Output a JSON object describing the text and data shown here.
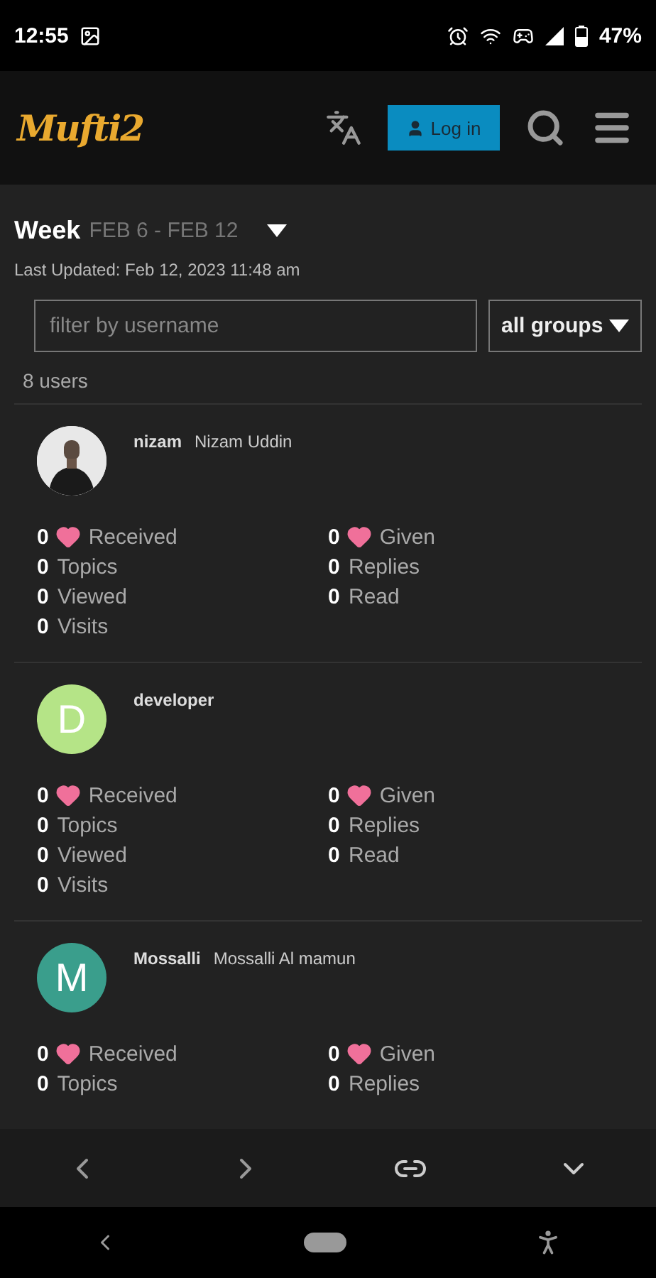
{
  "status_bar": {
    "time": "12:55",
    "battery": "47%"
  },
  "header": {
    "logo": "Mufti2",
    "login": "Log in"
  },
  "period": {
    "label": "Week",
    "range": "FEB 6 - FEB 12",
    "updated": "Last Updated: Feb 12, 2023 11:48 am"
  },
  "filter": {
    "placeholder": "filter by username",
    "group": "all groups"
  },
  "count": "8 users",
  "users": [
    {
      "username": "nizam",
      "name": "Nizam Uddin",
      "stats": [
        {
          "value": "0",
          "label": "Received",
          "kind": "like"
        },
        {
          "value": "0",
          "label": "Given",
          "kind": "like"
        },
        {
          "text": "**0** Topics",
          "kind": "plain"
        },
        {
          "text": "**0** Replies",
          "kind": "plain"
        },
        {
          "text": "**0** Viewed",
          "kind": "plain"
        },
        {
          "text": "**0** Read",
          "kind": "plain"
        },
        {
          "text": "**0** Visits",
          "kind": "plain"
        }
      ]
    },
    {
      "avatar": {
        "kind": "letter",
        "letter": "D",
        "color": "#b5e487"
      },
      "username": "developer",
      "stats": [
        {
          "value": "0",
          "label": "Received",
          "kind": "like"
        },
        {
          "value": "0",
          "label": "Given",
          "kind": "like"
        },
        {
          "text": "**0** Topics",
          "kind": "plain"
        },
        {
          "text": "**0** Replies",
          "kind": "plain"
        },
        {
          "text": "**0** Viewed",
          "kind": "plain"
        },
        {
          "text": "**0** Read",
          "kind": "plain"
        },
        {
          "text": "**0** Visits",
          "kind": "plain"
        }
      ]
    },
    {
      "avatar": {
        "kind": "letter",
        "letter": "M",
        "color": "#3a9e8c"
      },
      "username": "Mossalli",
      "name": "Mossalli Al mamun",
      "stats": [
        {
          "value": "0",
          "label": "Received",
          "kind": "like"
        },
        {
          "value": "0",
          "label": "Given",
          "kind": "like"
        },
        {
          "text": "**0** Topics",
          "kind": "plain"
        },
        {
          "text": "**0** Replies",
          "kind": "plain"
        }
      ]
    }
  ]
}
